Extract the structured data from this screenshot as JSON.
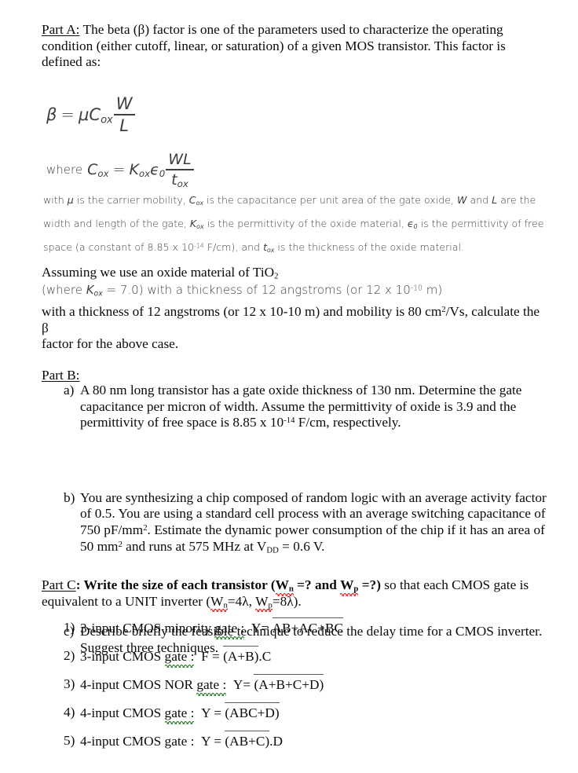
{
  "document": {
    "type": "homework-assignment",
    "page_background": "#ffffff",
    "body_text_color": "#0b0b0b",
    "math_text_color": "#3f3f3f",
    "spellcheck_red": "#e01b1b",
    "grammarcheck_green": "#1f7a1f"
  },
  "part_a": {
    "label": "Part A:",
    "intro_line1": "The beta (β) factor is one of the parameters used to characterize the operating",
    "intro_line2": "condition (either cutoff, linear, or saturation) of a given MOS transistor. This factor is",
    "intro_line3": "defined as:",
    "equation_1": {
      "lhs": "β",
      "equals": "=",
      "mu": "μ",
      "c_base": "C",
      "c_sub": "ox",
      "frac_num": "W",
      "frac_den": "L"
    },
    "equation_2": {
      "where": "where",
      "c_base": "C",
      "c_sub": "ox",
      "equals": "=",
      "kappa_base": "Κ",
      "kappa_sub": "ox",
      "epsilon_base": "ϵ",
      "epsilon_sub": "0",
      "frac_num": "WL",
      "frac_den_base": "t",
      "frac_den_sub": "ox"
    },
    "definitions": {
      "seg1": "with ",
      "mu": "μ",
      "seg2": " is the carrier mobility, ",
      "cox_base": "C",
      "cox_sub": "ox",
      "seg3": " is the capacitance per unit area of the gate oxide, ",
      "w": "W",
      "seg4": " and ",
      "l": "L",
      "seg5": " are the width and length of the gate, ",
      "kox_base": "Κ",
      "kox_sub": "ox",
      "seg6": " is the permittivity of the oxide material, ",
      "eps_base": "ϵ",
      "eps_sub": "0",
      "seg7": " is the permittivity of free space (a constant of 8.85 x 10",
      "sup1": "-14",
      "seg8": " F/cm), and ",
      "tox_base": "t",
      "tox_sub": "ox",
      "seg9": " is the thickness of the oxide material."
    },
    "assume_line1_a": "Assuming we use an oxide material of TiO",
    "assume_line1_sub": "2",
    "assume_line2_a": "(where ",
    "assume_line2_k": "Κ",
    "assume_line2_ksub": "ox",
    "assume_line2_b": " = 7.0) with a thickness of 12 angstroms (or 12 x 10",
    "assume_line2_sup": "-10",
    "assume_line2_c": " m)",
    "assume_line3_a": "with a thickness of 12 angstroms (or 12 x 10-10 m) and mobility is 80 cm",
    "assume_line3_sup": "2",
    "assume_line3_b": "/Vs, calculate the β",
    "assume_line4": "factor for the above case."
  },
  "part_b": {
    "label": "Part B:",
    "items": [
      {
        "marker": "a)",
        "line1": "A 80 nm long transistor has a gate oxide thickness of 130 nm. Determine the gate",
        "line2": "capacitance per micron of width. Assume the permittivity of oxide is 3.9 and the",
        "line3_a": "permittivity of free space is 8.85 x 10",
        "line3_sup": "-14",
        "line3_b": " F/cm, respectively."
      },
      {
        "marker": "b)",
        "line1": "You are synthesizing a chip composed of random logic with an average activity factor",
        "line2": "of 0.5. You are using a standard cell process with an average switching capacitance of",
        "line3_a": "750 pF/mm",
        "line3_sup": "2",
        "line3_b": ". Estimate the dynamic power consumption of the chip if it has an area of",
        "line4_a": "50 mm",
        "line4_sup": "2",
        "line4_b": " and runs at 575 MHz at V",
        "line4_sub": "DD",
        "line4_c": " = 0.6 V."
      },
      {
        "marker": "c)",
        "line1": "Describe briefly the feasible technique to reduce the delay time for a CMOS inverter.",
        "line2": "Suggest three techniques."
      }
    ]
  },
  "part_c": {
    "label": "Part C",
    "head_colon": ": ",
    "head_bold_1": "Write the size of each transistor (",
    "head_wn_1": "W",
    "head_wn_1_sub": "n",
    "head_bold_2": " =? and ",
    "head_wp_1": "W",
    "head_wp_1_sub": "p",
    "head_bold_3": " =?)",
    "head_rest_1": " so that each CMOS gate is",
    "head_line2_a": "equivalent to a UNIT inverter (",
    "head_wn_2": "W",
    "head_wn_2_sub": "n",
    "head_line2_b": "=4λ, ",
    "head_wp_2": "W",
    "head_wp_2_sub": "p",
    "head_line2_c": "=8λ).",
    "items": [
      {
        "marker": "1)",
        "desc": "3-input CMOS minority ",
        "gate_word": "gate :",
        "spellcheck": "green",
        "result_label": "Y=",
        "overline_expr": "AB+AC+BC",
        "tail": ""
      },
      {
        "marker": "2)",
        "desc": "3-input CMOS ",
        "gate_word": "gate :",
        "spellcheck": "green",
        "result_label": "F =",
        "overline_expr": "(A+B)",
        "tail": ".C"
      },
      {
        "marker": "3)",
        "desc": "4-input CMOS NOR ",
        "gate_word": "gate :",
        "spellcheck": "green",
        "result_label": "Y=",
        "overline_expr": "(A+B+C+D)",
        "tail": ""
      },
      {
        "marker": "4)",
        "desc": "4-input CMOS ",
        "gate_word": "gate :",
        "spellcheck": "green",
        "result_label": "Y =",
        "overline_expr": "(ABC+D)",
        "tail": ""
      },
      {
        "marker": "5)",
        "desc": "4-input CMOS ",
        "gate_word": "gate :",
        "spellcheck": "none",
        "result_label": "Y =",
        "overline_expr": "(AB+C)",
        "tail": ".D"
      }
    ]
  }
}
